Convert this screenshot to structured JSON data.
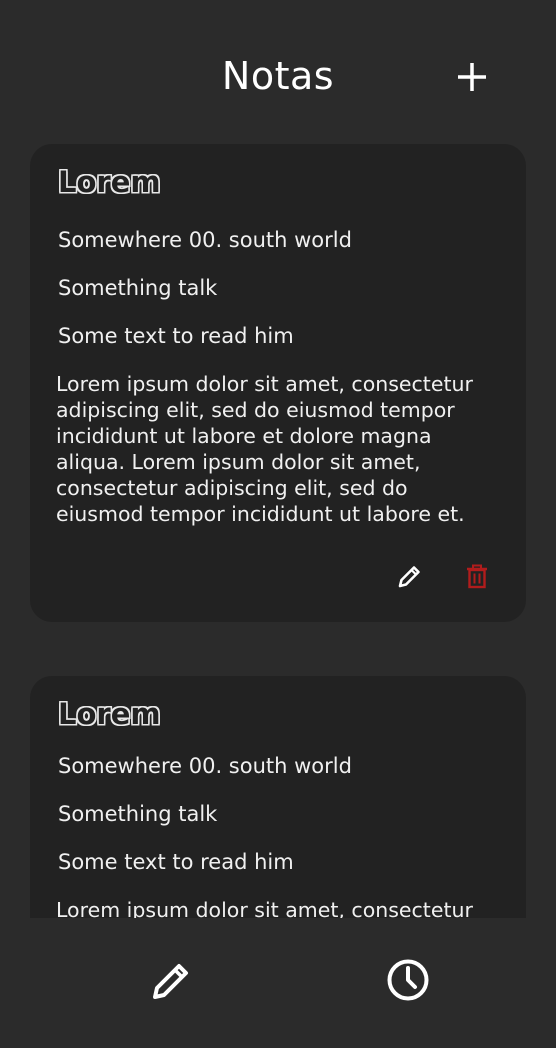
{
  "header": {
    "title": "Notas",
    "add_icon": "plus-icon"
  },
  "notes": [
    {
      "title": "Lorem",
      "lines": [
        "Somewhere 00. south world",
        "Something talk",
        "Some text to read him"
      ],
      "body": "Lorem ipsum dolor sit amet, consectetur adipiscing elit, sed do eiusmod tempor incididunt ut labore et dolore magna aliqua. Lorem ipsum dolor sit amet, consectetur adipiscing elit, sed do eiusmod tempor incididunt ut labore et.",
      "actions": {
        "edit_icon": "pencil-icon",
        "delete_icon": "trash-icon"
      }
    },
    {
      "title": "Lorem",
      "lines": [
        "Somewhere 00. south world",
        "Something talk",
        "Some text to read him"
      ],
      "body": "Lorem ipsum dolor sit amet, consectetur"
    }
  ],
  "bottom_nav": {
    "items": [
      {
        "icon": "pencil-icon"
      },
      {
        "icon": "clock-icon"
      }
    ]
  },
  "colors": {
    "background": "#2b2b2b",
    "card": "#222222",
    "text": "#f0f0f0",
    "delete": "#b11c1c"
  }
}
